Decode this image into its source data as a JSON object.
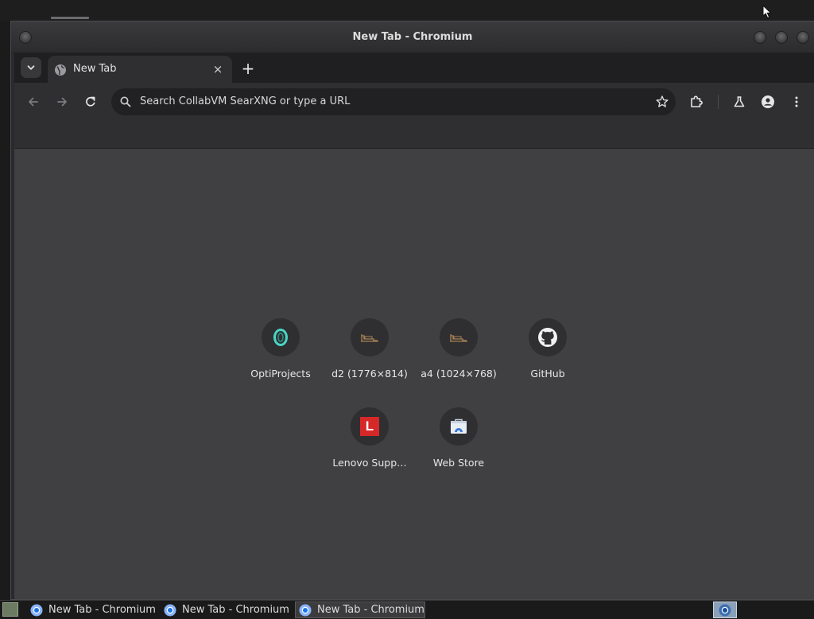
{
  "window": {
    "title": "New Tab - Chromium"
  },
  "tab": {
    "label": "New Tab",
    "close_glyph": "×"
  },
  "newtab_glyph": "+",
  "omnibox": {
    "text": "Search CollabVM SearXNG or type a URL"
  },
  "shortcuts": [
    {
      "label": "OptiProjects",
      "icon": "optiprojects-icon"
    },
    {
      "label": "d2 (1776×814)",
      "icon": "image-thumb-icon"
    },
    {
      "label": "a4 (1024×768)",
      "icon": "image-thumb-icon"
    },
    {
      "label": "GitHub",
      "icon": "github-icon"
    },
    {
      "label": "Lenovo Supp…",
      "icon": "lenovo-icon",
      "icon_text": "L"
    },
    {
      "label": "Web Store",
      "icon": "web-store-icon"
    }
  ],
  "taskbar": {
    "tasks": [
      {
        "label": "New Tab - Chromium"
      },
      {
        "label": "New Tab - Chromium"
      },
      {
        "label": "New Tab - Chromium"
      }
    ]
  },
  "colors": {
    "content_bg": "#404043",
    "lenovo_red": "#d62828",
    "optiprojects_teal": "#49d6c4"
  }
}
